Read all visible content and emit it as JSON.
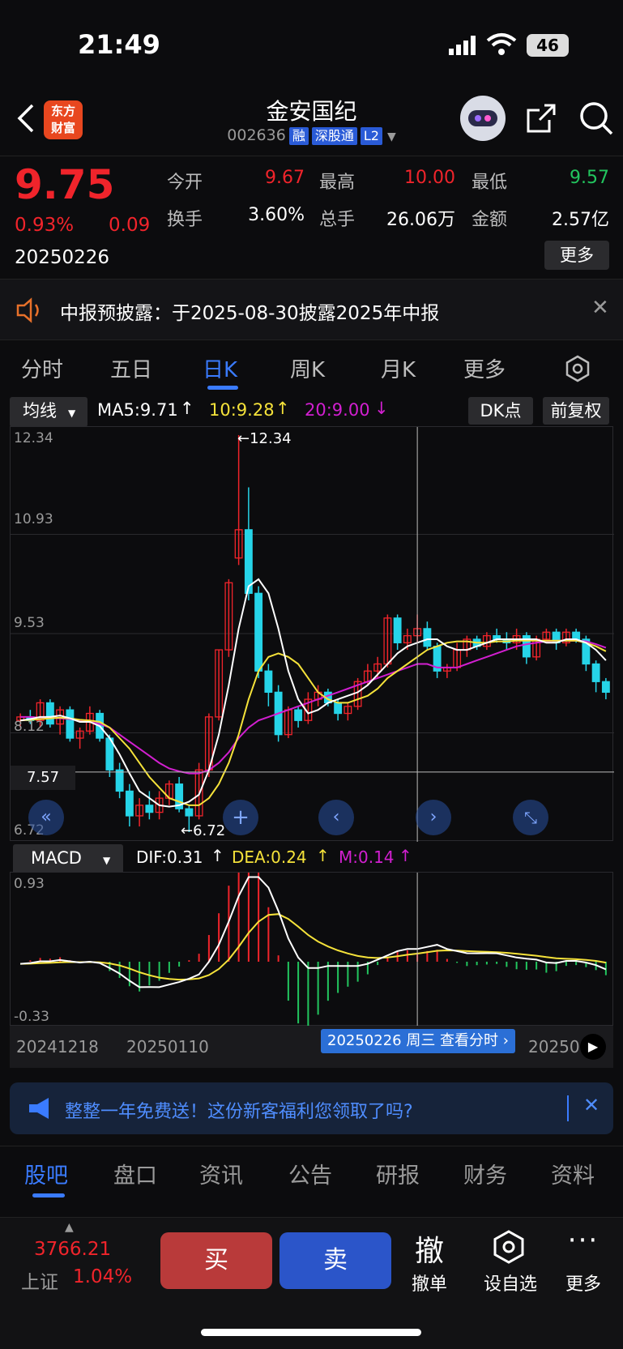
{
  "status": {
    "time": "21:49",
    "battery": "46"
  },
  "nav": {
    "logo_line1": "东方",
    "logo_line2": "财富",
    "title": "金安国纪",
    "code": "002636",
    "tags": [
      "融",
      "深股通",
      "L2"
    ]
  },
  "quote": {
    "price": "9.75",
    "change_pct": "0.93%",
    "change": "0.09",
    "date": "20250226",
    "stats": [
      {
        "label": "今开",
        "value": "9.67",
        "color": "red"
      },
      {
        "label": "最高",
        "value": "10.00",
        "color": "red"
      },
      {
        "label": "最低",
        "value": "9.57",
        "color": "green"
      },
      {
        "label": "换手",
        "value": "3.60%",
        "color": "white"
      },
      {
        "label": "总手",
        "value": "26.06万",
        "color": "white"
      },
      {
        "label": "金额",
        "value": "2.57亿",
        "color": "white"
      }
    ],
    "more": "更多"
  },
  "notice": {
    "text": "中报预披露：于2025-08-30披露2025年中报"
  },
  "tabs": [
    {
      "label": "分时",
      "active": false
    },
    {
      "label": "五日",
      "active": false
    },
    {
      "label": "日K",
      "active": true
    },
    {
      "label": "周K",
      "active": false
    },
    {
      "label": "月K",
      "active": false
    },
    {
      "label": "更多",
      "active": false
    }
  ],
  "indicator": {
    "selector": "均线",
    "ma5": "MA5:9.71",
    "ma10": "10:9.28",
    "ma20": "20:9.00",
    "dk": "DK点",
    "fq": "前复权",
    "colors": {
      "ma5": "#ffffff",
      "ma10": "#f5e23a",
      "ma20": "#d21fd0"
    }
  },
  "kline_labels": {
    "high_axis": "12.34",
    "mid1": "10.93",
    "mid2": "9.53",
    "mid3": "8.12",
    "low_axis": "6.72",
    "cursor_price": "7.57",
    "max_mark": "12.34",
    "min_mark": "6.72"
  },
  "macd": {
    "selector": "MACD",
    "dif": "DIF:0.31",
    "dea": "DEA:0.24",
    "m": "M:0.14",
    "top": "0.93",
    "bottom": "-0.33"
  },
  "dates": {
    "d1": "20241218",
    "d2": "20250110",
    "d3": "202502",
    "d4": "20250",
    "cursor": "20250226 周三 查看分时"
  },
  "chart_data": {
    "type": "candlestick",
    "ylim": [
      6.72,
      12.34
    ],
    "candles": [
      [
        8.3,
        8.4,
        8.2,
        8.35
      ],
      [
        8.35,
        8.45,
        8.25,
        8.3
      ],
      [
        8.3,
        8.6,
        8.2,
        8.55
      ],
      [
        8.55,
        8.6,
        8.2,
        8.25
      ],
      [
        8.25,
        8.5,
        8.1,
        8.45
      ],
      [
        8.45,
        8.5,
        8.0,
        8.05
      ],
      [
        8.05,
        8.2,
        7.9,
        8.15
      ],
      [
        8.15,
        8.5,
        8.1,
        8.4
      ],
      [
        8.4,
        8.45,
        8.0,
        8.05
      ],
      [
        8.05,
        8.1,
        7.5,
        7.6
      ],
      [
        7.6,
        7.7,
        7.2,
        7.3
      ],
      [
        7.3,
        7.4,
        6.8,
        6.95
      ],
      [
        6.95,
        7.2,
        6.8,
        7.1
      ],
      [
        7.1,
        7.3,
        6.9,
        7.0
      ],
      [
        7.0,
        7.3,
        6.9,
        7.2
      ],
      [
        7.2,
        7.45,
        7.1,
        7.4
      ],
      [
        7.4,
        7.5,
        7.0,
        7.05
      ],
      [
        7.05,
        7.1,
        6.72,
        6.95
      ],
      [
        6.95,
        7.7,
        6.9,
        7.6
      ],
      [
        7.6,
        8.4,
        7.5,
        8.35
      ],
      [
        8.35,
        9.3,
        8.3,
        9.3
      ],
      [
        9.3,
        10.3,
        9.2,
        10.25
      ],
      [
        10.6,
        12.34,
        10.5,
        11.0
      ],
      [
        11.0,
        11.6,
        10.0,
        10.1
      ],
      [
        10.1,
        10.2,
        8.9,
        9.0
      ],
      [
        9.0,
        9.1,
        8.5,
        8.7
      ],
      [
        8.7,
        8.8,
        8.0,
        8.1
      ],
      [
        8.1,
        8.5,
        8.05,
        8.45
      ],
      [
        8.45,
        8.5,
        8.2,
        8.3
      ],
      [
        8.3,
        8.7,
        8.25,
        8.6
      ],
      [
        8.6,
        8.8,
        8.5,
        8.7
      ],
      [
        8.7,
        8.75,
        8.5,
        8.55
      ],
      [
        8.55,
        8.6,
        8.3,
        8.4
      ],
      [
        8.4,
        8.55,
        8.3,
        8.5
      ],
      [
        8.5,
        8.9,
        8.45,
        8.85
      ],
      [
        8.85,
        9.1,
        8.8,
        9.0
      ],
      [
        9.0,
        9.2,
        8.9,
        9.1
      ],
      [
        9.1,
        9.8,
        9.05,
        9.75
      ],
      [
        9.75,
        9.8,
        9.3,
        9.4
      ],
      [
        9.4,
        9.6,
        9.3,
        9.5
      ],
      [
        9.5,
        9.8,
        9.4,
        9.6
      ],
      [
        9.6,
        9.7,
        9.3,
        9.35
      ],
      [
        9.35,
        9.4,
        8.9,
        9.0
      ],
      [
        9.0,
        9.1,
        8.9,
        9.05
      ],
      [
        9.05,
        9.4,
        9.0,
        9.3
      ],
      [
        9.3,
        9.5,
        9.2,
        9.45
      ],
      [
        9.45,
        9.5,
        9.3,
        9.35
      ],
      [
        9.35,
        9.55,
        9.3,
        9.5
      ],
      [
        9.5,
        9.6,
        9.4,
        9.45
      ],
      [
        9.45,
        9.55,
        9.3,
        9.4
      ],
      [
        9.4,
        9.6,
        9.3,
        9.5
      ],
      [
        9.5,
        9.55,
        9.1,
        9.2
      ],
      [
        9.2,
        9.5,
        9.15,
        9.45
      ],
      [
        9.45,
        9.6,
        9.4,
        9.55
      ],
      [
        9.55,
        9.6,
        9.3,
        9.4
      ],
      [
        9.4,
        9.6,
        9.35,
        9.55
      ],
      [
        9.55,
        9.6,
        9.4,
        9.45
      ],
      [
        9.45,
        9.5,
        9.0,
        9.1
      ],
      [
        9.1,
        9.15,
        8.7,
        8.85
      ],
      [
        8.85,
        8.9,
        8.6,
        8.7
      ]
    ],
    "ma5": [
      8.3,
      8.32,
      8.35,
      8.35,
      8.37,
      8.33,
      8.28,
      8.28,
      8.22,
      8.05,
      7.82,
      7.55,
      7.3,
      7.2,
      7.1,
      7.08,
      7.1,
      7.15,
      7.25,
      7.6,
      8.1,
      8.8,
      9.6,
      10.2,
      10.3,
      10.1,
      9.6,
      9.0,
      8.6,
      8.4,
      8.45,
      8.55,
      8.6,
      8.65,
      8.7,
      8.8,
      8.95,
      9.1,
      9.25,
      9.35,
      9.4,
      9.45,
      9.45,
      9.35,
      9.3,
      9.3,
      9.35,
      9.4,
      9.45,
      9.45,
      9.45,
      9.45,
      9.45,
      9.4,
      9.4,
      9.45,
      9.45,
      9.4,
      9.3,
      9.15
    ],
    "ma10": [
      8.3,
      8.31,
      8.32,
      8.33,
      8.34,
      8.33,
      8.31,
      8.3,
      8.28,
      8.2,
      8.05,
      7.9,
      7.7,
      7.5,
      7.35,
      7.2,
      7.15,
      7.1,
      7.1,
      7.2,
      7.4,
      7.7,
      8.1,
      8.6,
      9.0,
      9.2,
      9.25,
      9.2,
      9.1,
      8.9,
      8.7,
      8.6,
      8.55,
      8.55,
      8.6,
      8.65,
      8.75,
      8.9,
      9.0,
      9.1,
      9.2,
      9.3,
      9.35,
      9.4,
      9.42,
      9.42,
      9.4,
      9.4,
      9.42,
      9.42,
      9.43,
      9.43,
      9.43,
      9.43,
      9.43,
      9.43,
      9.43,
      9.4,
      9.35,
      9.28
    ],
    "ma20": [
      8.35,
      8.35,
      8.34,
      8.34,
      8.33,
      8.32,
      8.3,
      8.28,
      8.25,
      8.2,
      8.1,
      8.0,
      7.9,
      7.8,
      7.7,
      7.62,
      7.58,
      7.55,
      7.55,
      7.6,
      7.7,
      7.85,
      8.05,
      8.2,
      8.3,
      8.35,
      8.4,
      8.45,
      8.5,
      8.55,
      8.6,
      8.65,
      8.7,
      8.75,
      8.8,
      8.85,
      8.9,
      8.95,
      9.0,
      9.05,
      9.1,
      9.1,
      9.05,
      9.05,
      9.05,
      9.1,
      9.15,
      9.2,
      9.25,
      9.3,
      9.35,
      9.38,
      9.4,
      9.42,
      9.43,
      9.43,
      9.43,
      9.42,
      9.38,
      9.33
    ]
  }
}
